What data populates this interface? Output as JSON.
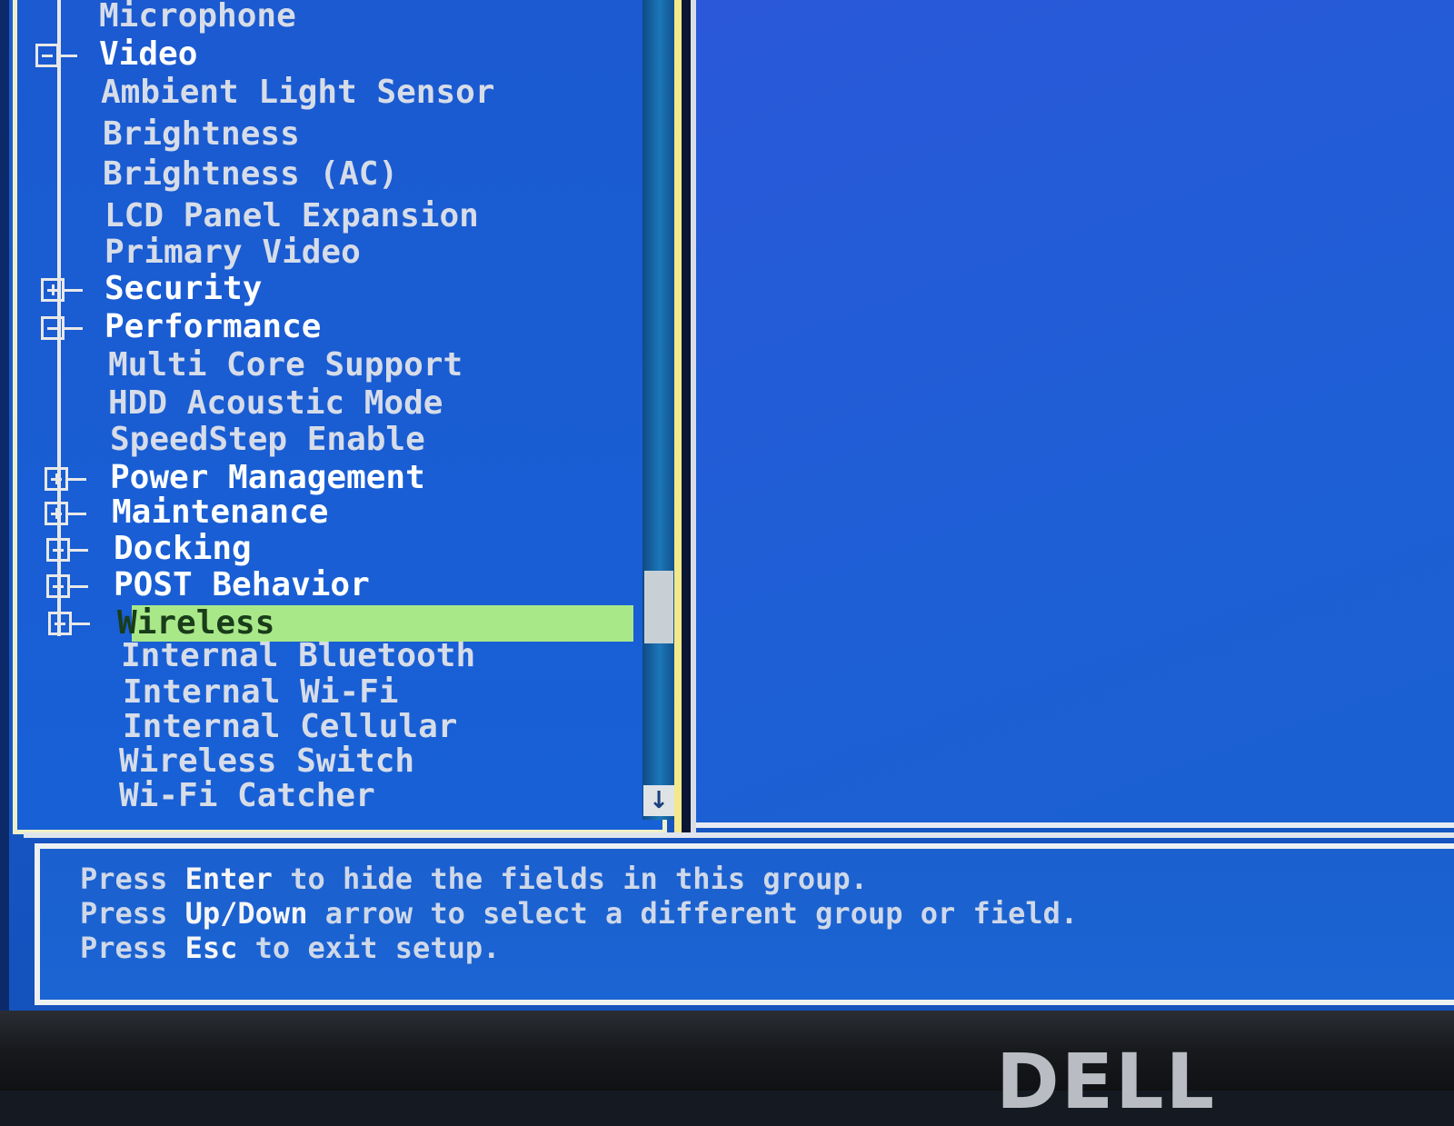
{
  "tree": {
    "rows": [
      {
        "label": "Microphone",
        "kind": "child"
      },
      {
        "label": "Video",
        "kind": "group",
        "state": "expanded"
      },
      {
        "label": "Ambient Light Sensor",
        "kind": "child"
      },
      {
        "label": "Brightness",
        "kind": "child"
      },
      {
        "label": "Brightness (AC)",
        "kind": "child"
      },
      {
        "label": "LCD Panel Expansion",
        "kind": "child"
      },
      {
        "label": "Primary Video",
        "kind": "child"
      },
      {
        "label": "Security",
        "kind": "group",
        "state": "collapsed"
      },
      {
        "label": "Performance",
        "kind": "group",
        "state": "expanded"
      },
      {
        "label": "Multi Core Support",
        "kind": "child"
      },
      {
        "label": "HDD Acoustic Mode",
        "kind": "child"
      },
      {
        "label": "SpeedStep Enable",
        "kind": "child"
      },
      {
        "label": "Power Management",
        "kind": "group",
        "state": "collapsed"
      },
      {
        "label": "Maintenance",
        "kind": "group",
        "state": "collapsed"
      },
      {
        "label": "Docking",
        "kind": "group",
        "state": "collapsed"
      },
      {
        "label": "POST Behavior",
        "kind": "group",
        "state": "collapsed"
      },
      {
        "label": "Wireless",
        "kind": "group",
        "state": "expanded",
        "selected": true
      },
      {
        "label": "Internal Bluetooth",
        "kind": "child"
      },
      {
        "label": "Internal Wi-Fi",
        "kind": "child"
      },
      {
        "label": "Internal Cellular",
        "kind": "child"
      },
      {
        "label": "Wireless Switch",
        "kind": "child"
      },
      {
        "label": "Wi-Fi Catcher",
        "kind": "child"
      }
    ]
  },
  "scrollbar": {
    "down_arrow_icon": "arrow-down-icon",
    "position_fraction": 0.72
  },
  "help": {
    "line1": {
      "pre": "Press ",
      "key": "Enter",
      "post": " to hide the fields in this group."
    },
    "line2": {
      "pre": "Press ",
      "key": "Up/Down",
      "post": " arrow to select a different group or field."
    },
    "line3": {
      "pre": "Press ",
      "key": "Esc",
      "post": " to exit setup."
    }
  },
  "bezel": {
    "brand": "DELL"
  },
  "colors": {
    "background_blue": "#1b5ad0",
    "selection_green": "#a9e889",
    "border_yellow": "#f3e98a",
    "text_white": "#f4f4f4"
  }
}
